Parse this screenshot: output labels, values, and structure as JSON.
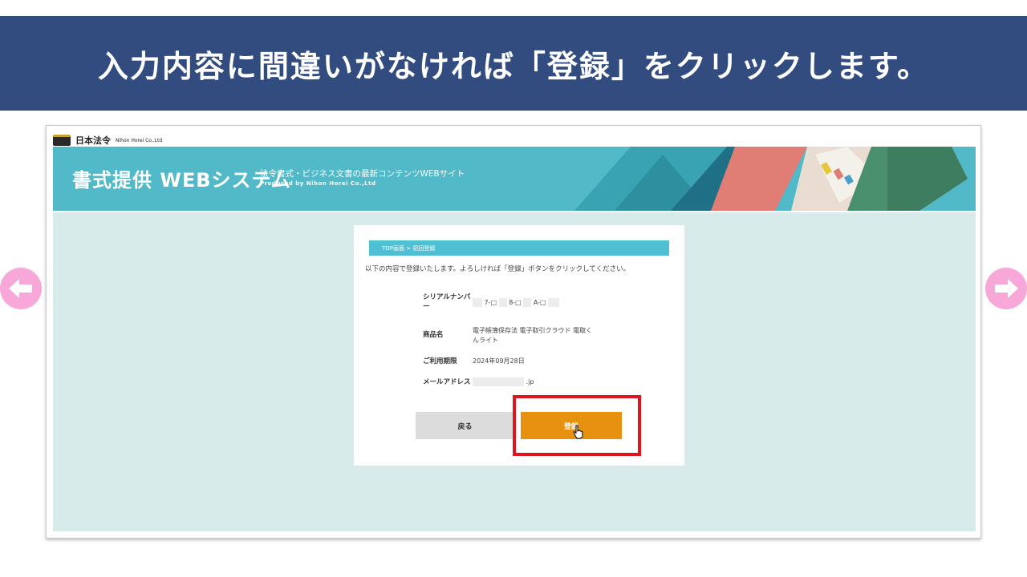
{
  "banner": {
    "title": "入力内容に間違いがなければ「登録」をクリックします。"
  },
  "nav": {
    "prev_icon": "arrow-left-icon",
    "next_icon": "arrow-right-icon",
    "arrow_color": "#f7a8d8"
  },
  "site": {
    "logo_jp": "日本法令",
    "logo_en": "Nihon Horei Co.,Ltd",
    "hero_title": "書式提供 WEBシステム",
    "hero_sub": "法令書式・ビジネス文書の最新コンテンツWEBサイト",
    "hero_produced": "Produced by Nihon Horei Co.,Ltd"
  },
  "form": {
    "breadcrumb": "TOP画面 > 初回登録",
    "lead": "以下の内容で登録いたします。よろしければ「登録」ボタンをクリックしてください。",
    "serial_label": "シリアルナンバー",
    "serial_value_parts": [
      "7-□",
      "8-□",
      "A-□"
    ],
    "product_label": "商品名",
    "product_value": "電子帳簿保存法 電子取引クラウド 電取くんライト",
    "expiry_label": "ご利用期限",
    "expiry_value": "2024年09月28日",
    "email_label": "メールアドレス",
    "email_value_suffix": ".jp",
    "back_label": "戻る",
    "register_label": "登録"
  },
  "colors": {
    "banner": "#324c80",
    "hero": "#52b9c8",
    "content_bg": "#d8ebeb",
    "register": "#e8900f",
    "highlight": "#e0141c"
  }
}
